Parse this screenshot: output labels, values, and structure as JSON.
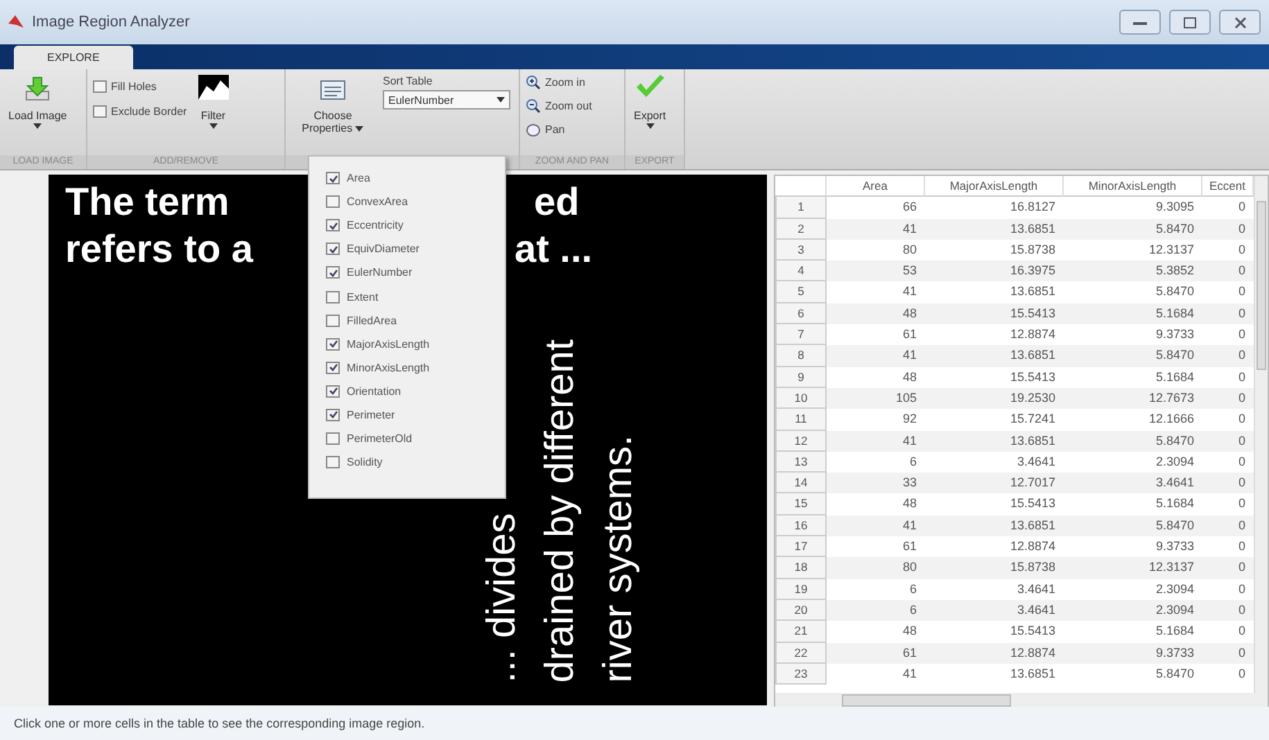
{
  "window": {
    "title": "Image Region Analyzer"
  },
  "tabs": [
    {
      "label": "EXPLORE",
      "selected": true
    }
  ],
  "ribbon": {
    "load_image": {
      "label": "Load Image",
      "group": "LOAD IMAGE"
    },
    "add_remove": {
      "options": [
        {
          "label": "Fill Holes",
          "checked": false
        },
        {
          "label": "Exclude Border",
          "checked": false
        }
      ],
      "filter": "Filter",
      "group": "ADD/REMOVE"
    },
    "properties": {
      "label": "Choose Properties",
      "sort_label": "Sort Table",
      "sort_value": "EulerNumber"
    },
    "zoom": {
      "items": [
        {
          "label": "Zoom in",
          "kind": "zoomin"
        },
        {
          "label": "Zoom out",
          "kind": "zoomout"
        },
        {
          "label": "Pan",
          "kind": "pan"
        }
      ],
      "group": "ZOOM AND PAN"
    },
    "export": {
      "label": "Export",
      "group": "EXPORT"
    }
  },
  "properties_menu": [
    {
      "label": "Area",
      "checked": true
    },
    {
      "label": "ConvexArea",
      "checked": false
    },
    {
      "label": "Eccentricity",
      "checked": true
    },
    {
      "label": "EquivDiameter",
      "checked": true
    },
    {
      "label": "EulerNumber",
      "checked": true
    },
    {
      "label": "Extent",
      "checked": false
    },
    {
      "label": "FilledArea",
      "checked": false
    },
    {
      "label": "MajorAxisLength",
      "checked": true
    },
    {
      "label": "MinorAxisLength",
      "checked": true
    },
    {
      "label": "Orientation",
      "checked": true
    },
    {
      "label": "Perimeter",
      "checked": true
    },
    {
      "label": "PerimeterOld",
      "checked": false
    },
    {
      "label": "Solidity",
      "checked": false
    }
  ],
  "image": {
    "top_lines": [
      [
        "The term",
        "ed"
      ],
      [
        "refers to a",
        "at ..."
      ]
    ],
    "vertical_lines": [
      "... divides",
      "drained by different",
      "river systems."
    ]
  },
  "table": {
    "columns": [
      "",
      "Area",
      "MajorAxisLength",
      "MinorAxisLength",
      "Eccent"
    ],
    "rows": [
      [
        "1",
        "66",
        "16.8127",
        "9.3095",
        "0"
      ],
      [
        "2",
        "41",
        "13.6851",
        "5.8470",
        "0"
      ],
      [
        "3",
        "80",
        "15.8738",
        "12.3137",
        "0"
      ],
      [
        "4",
        "53",
        "16.3975",
        "5.3852",
        "0"
      ],
      [
        "5",
        "41",
        "13.6851",
        "5.8470",
        "0"
      ],
      [
        "6",
        "48",
        "15.5413",
        "5.1684",
        "0"
      ],
      [
        "7",
        "61",
        "12.8874",
        "9.3733",
        "0"
      ],
      [
        "8",
        "41",
        "13.6851",
        "5.8470",
        "0"
      ],
      [
        "9",
        "48",
        "15.5413",
        "5.1684",
        "0"
      ],
      [
        "10",
        "105",
        "19.2530",
        "12.7673",
        "0"
      ],
      [
        "11",
        "92",
        "15.7241",
        "12.1666",
        "0"
      ],
      [
        "12",
        "41",
        "13.6851",
        "5.8470",
        "0"
      ],
      [
        "13",
        "6",
        "3.4641",
        "2.3094",
        "0"
      ],
      [
        "14",
        "33",
        "12.7017",
        "3.4641",
        "0"
      ],
      [
        "15",
        "48",
        "15.5413",
        "5.1684",
        "0"
      ],
      [
        "16",
        "41",
        "13.6851",
        "5.8470",
        "0"
      ],
      [
        "17",
        "61",
        "12.8874",
        "9.3733",
        "0"
      ],
      [
        "18",
        "80",
        "15.8738",
        "12.3137",
        "0"
      ],
      [
        "19",
        "6",
        "3.4641",
        "2.3094",
        "0"
      ],
      [
        "20",
        "6",
        "3.4641",
        "2.3094",
        "0"
      ],
      [
        "21",
        "48",
        "15.5413",
        "5.1684",
        "0"
      ],
      [
        "22",
        "61",
        "12.8874",
        "9.3733",
        "0"
      ],
      [
        "23",
        "41",
        "13.6851",
        "5.8470",
        "0"
      ]
    ]
  },
  "status_bar": "Click one or more cells in the table to see the corresponding image region."
}
